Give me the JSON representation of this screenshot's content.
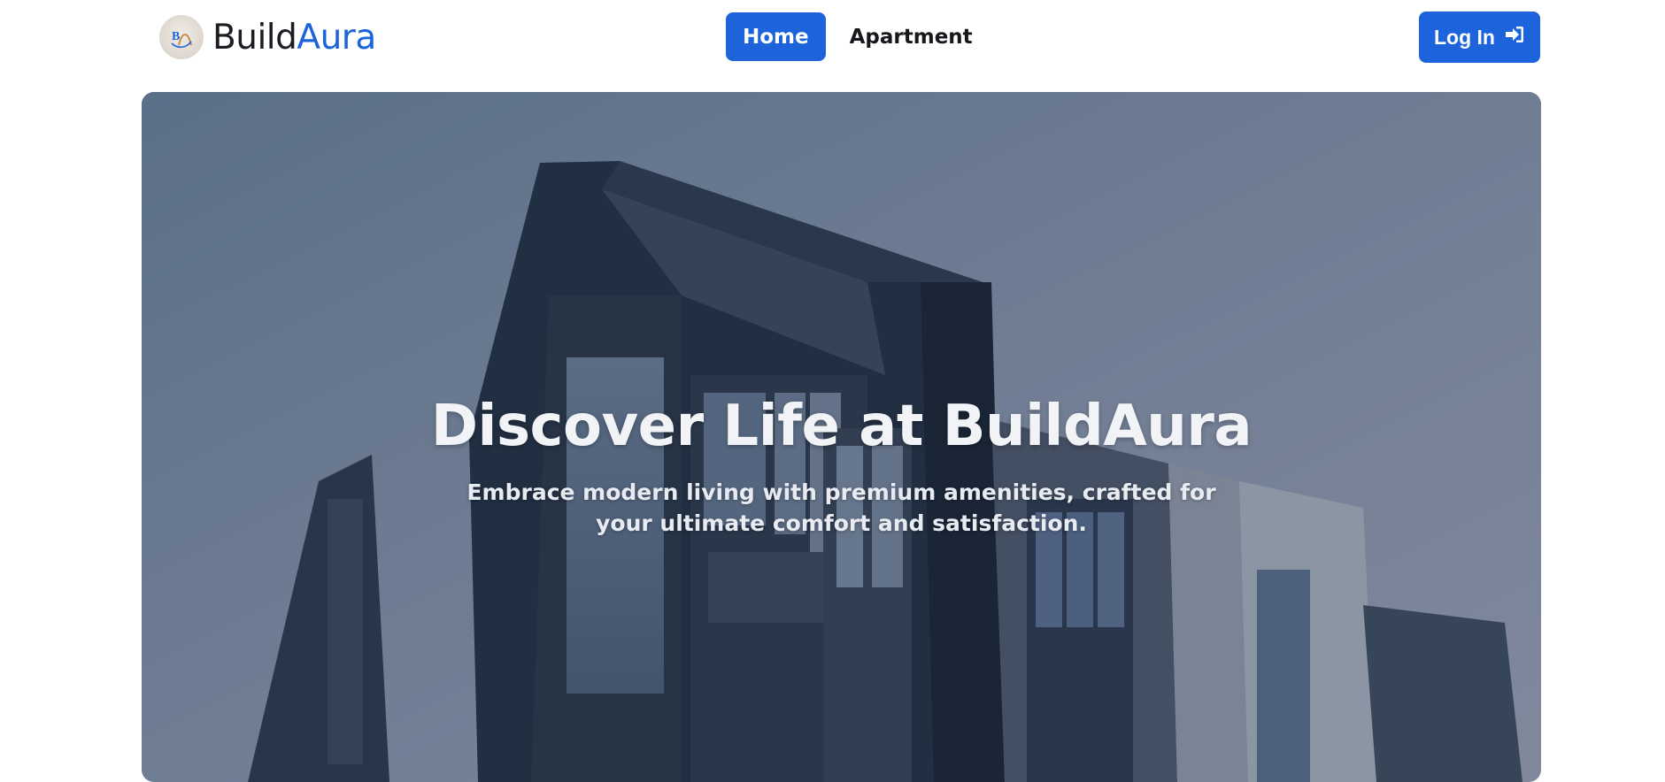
{
  "brand": {
    "name_part1": "Build",
    "name_part2": "Aura",
    "logo_icon": "buildaura-logo-icon"
  },
  "nav": {
    "items": [
      {
        "label": "Home",
        "active": true
      },
      {
        "label": "Apartment",
        "active": false
      }
    ]
  },
  "login": {
    "label": "Log In",
    "icon": "sign-in-icon"
  },
  "hero": {
    "title": "Discover Life at BuildAura",
    "subtitle": "Embrace modern living with premium amenities, crafted for your ultimate comfort and satisfaction."
  },
  "colors": {
    "accent": "#1d63dc",
    "text_dark": "#16181c"
  }
}
